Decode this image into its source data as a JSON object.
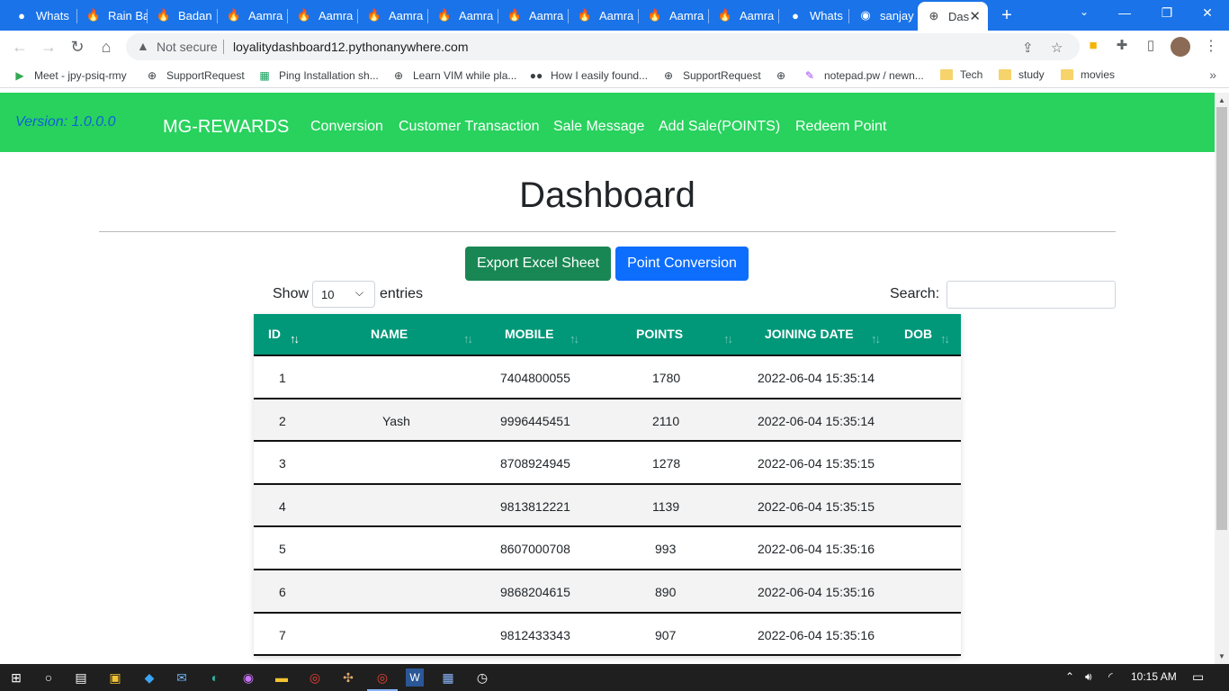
{
  "browser": {
    "tabs": [
      {
        "title": "Whats",
        "icon": "whatsapp-icon"
      },
      {
        "title": "Rain Ba",
        "icon": "fire-icon"
      },
      {
        "title": "Badan",
        "icon": "fire-icon"
      },
      {
        "title": "Aamra",
        "icon": "fire-icon"
      },
      {
        "title": "Aamra",
        "icon": "fire-icon"
      },
      {
        "title": "Aamra",
        "icon": "fire-icon"
      },
      {
        "title": "Aamra",
        "icon": "fire-icon"
      },
      {
        "title": "Aamra",
        "icon": "fire-icon"
      },
      {
        "title": "Aamra",
        "icon": "fire-icon"
      },
      {
        "title": "Aamra",
        "icon": "fire-icon"
      },
      {
        "title": "Aamra",
        "icon": "fire-icon"
      },
      {
        "title": "Whats",
        "icon": "whatsapp-icon"
      },
      {
        "title": "sanjay",
        "icon": "github-icon"
      },
      {
        "title": "Das",
        "icon": "globe-icon"
      }
    ],
    "security_label": "Not secure",
    "url": "loyalitydashboard12.pythonanywhere.com",
    "bookmarks": [
      {
        "label": "Meet - jpy-psiq-rmy",
        "icon": "meet-icon"
      },
      {
        "label": "SupportRequest",
        "icon": "globe-icon"
      },
      {
        "label": "Ping Installation sh...",
        "icon": "sheets-icon"
      },
      {
        "label": "Learn VIM while pla...",
        "icon": "globe-icon"
      },
      {
        "label": "How I easily found...",
        "icon": "medium-icon"
      },
      {
        "label": "SupportRequest",
        "icon": "globe-icon"
      },
      {
        "label": "",
        "icon": "globe-icon"
      },
      {
        "label": "notepad.pw / newn...",
        "icon": "notepad-icon"
      },
      {
        "label": "Tech",
        "icon": "folder-icon"
      },
      {
        "label": "study",
        "icon": "folder-icon"
      },
      {
        "label": "movies",
        "icon": "folder-icon"
      }
    ]
  },
  "navbar": {
    "version": "Version: 1.0.0.0",
    "brand": "MG-REWARDS",
    "links": [
      "Conversion",
      "Customer Transaction",
      "Sale Message",
      "Add Sale(POINTS)",
      "Redeem Point"
    ]
  },
  "main": {
    "title": "Dashboard",
    "export_button": "Export Excel Sheet",
    "conversion_button": "Point Conversion",
    "length_show": "Show",
    "length_value": "10",
    "length_entries": "entries",
    "search_label": "Search:",
    "search_value": ""
  },
  "table": {
    "columns": [
      "ID",
      "NAME",
      "MOBILE",
      "POINTS",
      "JOINING DATE",
      "DOB"
    ],
    "rows": [
      {
        "id": "1",
        "name": "",
        "mobile": "7404800055",
        "points": "1780",
        "joining_date": "2022-06-04 15:35:14",
        "dob": ""
      },
      {
        "id": "2",
        "name": "Yash",
        "mobile": "9996445451",
        "points": "2110",
        "joining_date": "2022-06-04 15:35:14",
        "dob": ""
      },
      {
        "id": "3",
        "name": "",
        "mobile": "8708924945",
        "points": "1278",
        "joining_date": "2022-06-04 15:35:15",
        "dob": ""
      },
      {
        "id": "4",
        "name": "",
        "mobile": "9813812221",
        "points": "1139",
        "joining_date": "2022-06-04 15:35:15",
        "dob": ""
      },
      {
        "id": "5",
        "name": "",
        "mobile": "8607000708",
        "points": "993",
        "joining_date": "2022-06-04 15:35:16",
        "dob": ""
      },
      {
        "id": "6",
        "name": "",
        "mobile": "9868204615",
        "points": "890",
        "joining_date": "2022-06-04 15:35:16",
        "dob": ""
      },
      {
        "id": "7",
        "name": "",
        "mobile": "9812433343",
        "points": "907",
        "joining_date": "2022-06-04 15:35:16",
        "dob": ""
      }
    ]
  },
  "taskbar": {
    "time": "10:15 AM"
  },
  "colors": {
    "browser_blue": "#1a73e8",
    "navbar_green": "#28d25d",
    "table_header": "#009879",
    "export_btn": "#198754",
    "primary_btn": "#0d6efd"
  }
}
